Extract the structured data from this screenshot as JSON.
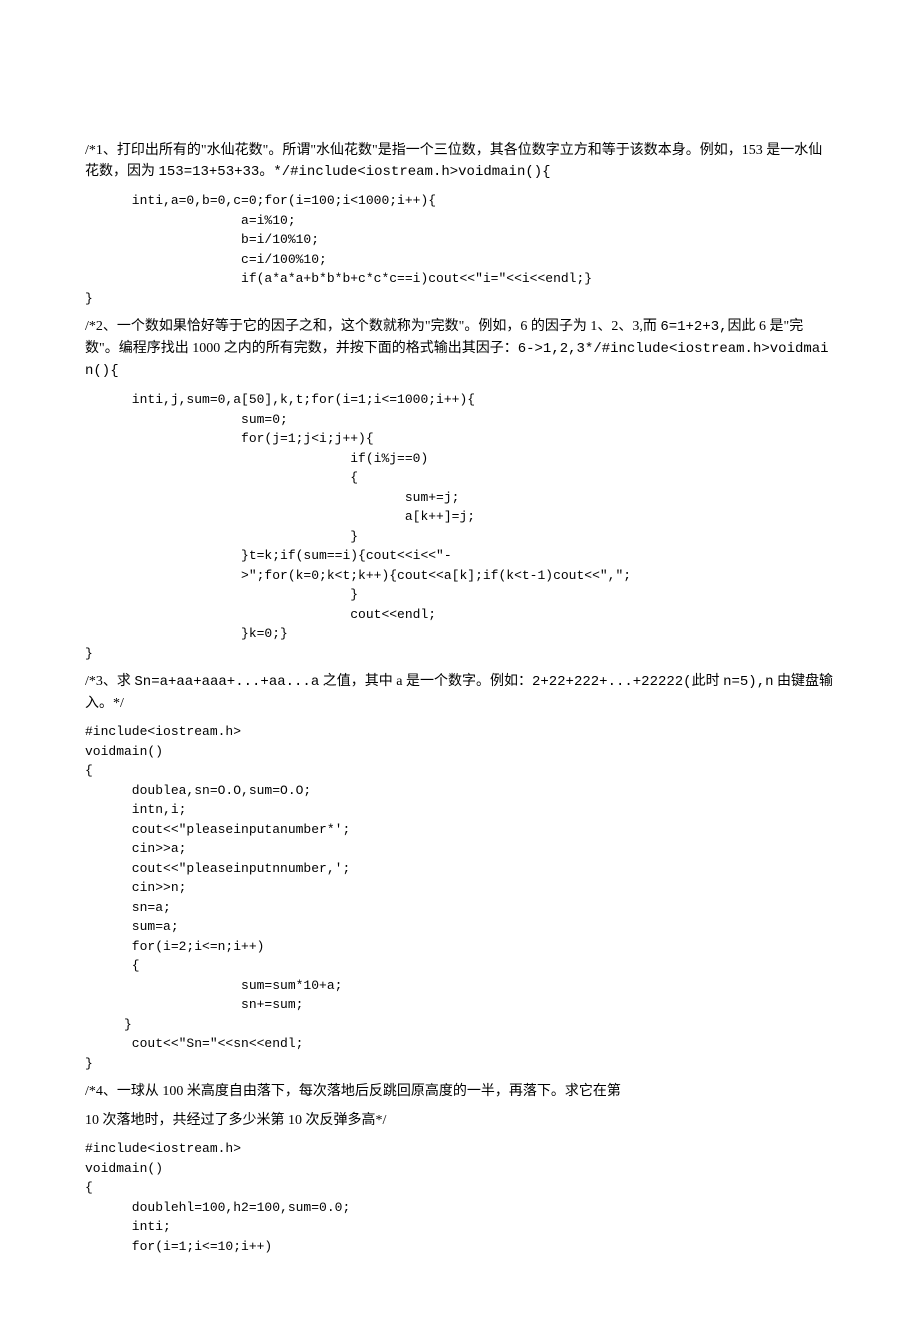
{
  "p1": {
    "desc_a": "/*1、打印出所有的\"水仙花数\"。所谓\"水仙花数\"是指一个三位数，其各位数字立方和等于该数本身。例如，153 是一水仙花数，因为 ",
    "desc_b": "153=13+53+33。*/#include<iostream.h>voidmain(){",
    "code": "      inti,a=0,b=0,c=0;for(i=100;i<1000;i++){\n                    a=i%10;\n                    b=i/10%10;\n                    c=i/100%10;\n                    if(a*a*a+b*b*b+c*c*c==i)cout<<\"i=\"<<i<<endl;}\n}"
  },
  "p2": {
    "desc_a": "/*2、一个数如果恰好等于它的因子之和，这个数就称为\"完数\"。例如，6 的因子为 1、2、3,而 ",
    "desc_b": "6=1+2+3,",
    "desc_c": "因此 6 是\"完数\"。编程序找出 1000 之内的所有完数，并按下面的格式输出其因子：",
    "desc_d": "6->1,2,3*/#include<iostream.h>voidmain(){",
    "code": "      inti,j,sum=0,a[50],k,t;for(i=1;i<=1000;i++){\n                    sum=0;\n                    for(j=1;j<i;j++){\n                                  if(i%j==0)\n                                  {\n                                         sum+=j;\n                                         a[k++]=j;\n                                  }\n                    }t=k;if(sum==i){cout<<i<<\"-\n                    >\";for(k=0;k<t;k++){cout<<a[k];if(k<t-1)cout<<\",\";\n                                  }\n                                  cout<<endl;\n                    }k=0;}\n}"
  },
  "p3": {
    "desc_a": "/*3、求 ",
    "desc_b": "Sn=a+aa+aaa+...+aa...a",
    "desc_c": " 之值，其中 a 是一个数字。例如：",
    "desc_d": "2+22+222+...+22222(",
    "desc_e": "此时 ",
    "desc_f": "n=5),n",
    "desc_g": " 由键盘输入。*/",
    "code": "#include<iostream.h>\nvoidmain()\n{\n      doublea,sn=O.O,sum=O.O;\n      intn,i;\n      cout<<\"pleaseinputanumber*';\n      cin>>a;\n      cout<<\"pleaseinputnnumber,';\n      cin>>n;\n      sn=a;\n      sum=a;\n      for(i=2;i<=n;i++)\n      {\n                    sum=sum*10+a;\n                    sn+=sum;\n     }\n      cout<<\"Sn=\"<<sn<<endl;\n}"
  },
  "p4": {
    "desc_a": "/*4、一球从 100 米高度自由落下，每次落地后反跳回原高度的一半，再落下。求它在第",
    "desc_b": "10 次落地时，共经过了多少米第 10 次反弹多高*/",
    "code": "#include<iostream.h>\nvoidmain()\n{\n      doublehl=100,h2=100,sum=0.0;\n      inti;\n      for(i=1;i<=10;i++)"
  }
}
